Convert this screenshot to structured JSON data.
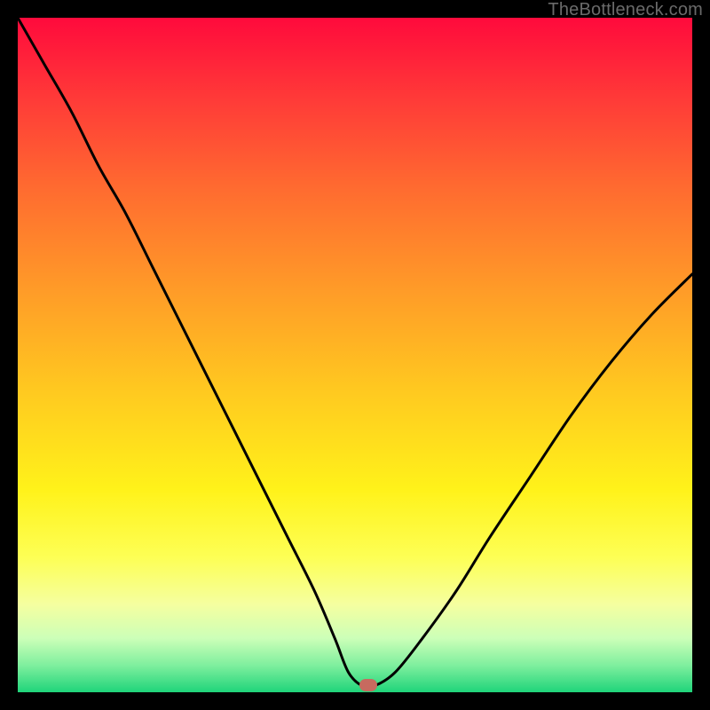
{
  "watermark": {
    "text": "TheBottleneck.com"
  },
  "colors": {
    "curve_stroke": "#000000",
    "marker_fill": "#c76a5f",
    "frame_bg": "#000000"
  },
  "chart_data": {
    "type": "line",
    "title": "",
    "xlabel": "",
    "ylabel": "",
    "xlim": [
      0,
      100
    ],
    "ylim": [
      0,
      100
    ],
    "grid": false,
    "legend": false,
    "series": [
      {
        "name": "bottleneck-curve",
        "x": [
          0,
          4,
          8,
          12,
          16,
          20,
          24,
          28,
          32,
          36,
          40,
          44,
          47,
          49,
          51,
          53,
          56,
          60,
          65,
          70,
          76,
          82,
          88,
          94,
          100
        ],
        "y": [
          100,
          93,
          86,
          78,
          71,
          63,
          55,
          47,
          39,
          31,
          23,
          15,
          8,
          3,
          1,
          1,
          3,
          8,
          15,
          23,
          32,
          41,
          49,
          56,
          62
        ]
      }
    ],
    "marker": {
      "x": 52,
      "y": 1
    },
    "gradient_stops": [
      {
        "p": 0,
        "c": "#ff0a3c"
      },
      {
        "p": 12,
        "c": "#ff3a38"
      },
      {
        "p": 25,
        "c": "#ff6a30"
      },
      {
        "p": 40,
        "c": "#ff9a28"
      },
      {
        "p": 55,
        "c": "#ffc820"
      },
      {
        "p": 70,
        "c": "#fff21a"
      },
      {
        "p": 80,
        "c": "#fdff55"
      },
      {
        "p": 87,
        "c": "#f5ffa0"
      },
      {
        "p": 92,
        "c": "#ccffb8"
      },
      {
        "p": 96,
        "c": "#7fef9e"
      },
      {
        "p": 100,
        "c": "#1fd47a"
      }
    ]
  }
}
